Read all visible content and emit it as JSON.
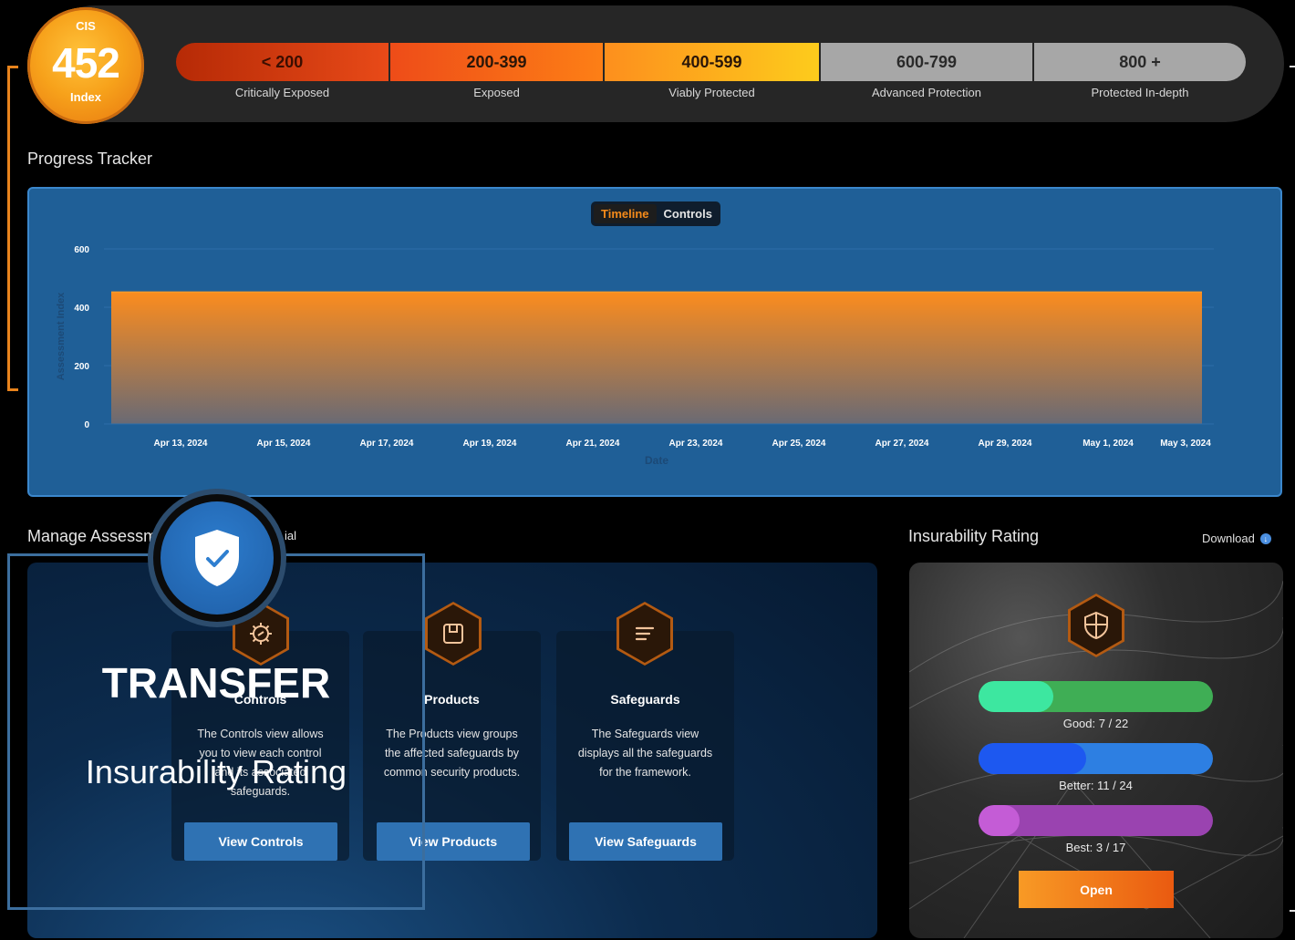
{
  "header": {
    "score": {
      "framework": "CIS",
      "value": "452",
      "label": "Index"
    },
    "bands": [
      {
        "range": "< 200",
        "label": "Critically Exposed"
      },
      {
        "range": "200-399",
        "label": "Exposed"
      },
      {
        "range": "400-599",
        "label": "Viably Protected"
      },
      {
        "range": "600-799",
        "label": "Advanced Protection"
      },
      {
        "range": "800 +",
        "label": "Protected In-depth"
      }
    ]
  },
  "progress": {
    "title": "Progress Tracker",
    "toggle": {
      "active": "Timeline",
      "inactive": "Controls"
    }
  },
  "chart_data": {
    "type": "area",
    "x": [
      "Apr 13, 2024",
      "Apr 15, 2024",
      "Apr 17, 2024",
      "Apr 19, 2024",
      "Apr 21, 2024",
      "Apr 23, 2024",
      "Apr 25, 2024",
      "Apr 27, 2024",
      "Apr 29, 2024",
      "May 1, 2024",
      "May 3, 2024"
    ],
    "series": [
      {
        "values": [
          452,
          452,
          452,
          452,
          452,
          452,
          452,
          452,
          452,
          452,
          452
        ]
      }
    ],
    "xlabel": "Date",
    "ylabel": "Assessment Index",
    "y_ticks": [
      "600",
      "400",
      "200",
      "0"
    ],
    "ylim": [
      0,
      600
    ],
    "grid": true,
    "fill_color_top": "#fb8c1e",
    "fill_color_bottom": "#6a6a74"
  },
  "manage": {
    "title_left": "Manage Assessm",
    "title_right": "ial",
    "cards": [
      {
        "title": "Controls",
        "desc": [
          "The Controls view allows",
          "you to view each control",
          "and its associated",
          "safeguards."
        ],
        "button": "View Controls",
        "icon": "gear-icon"
      },
      {
        "title": "Products",
        "desc": [
          "The Products view groups",
          "the affected safeguards by",
          "common security products."
        ],
        "button": "View Products",
        "icon": "box-icon"
      },
      {
        "title": "Safeguards",
        "desc": [
          "The Safeguards view",
          "displays all the safeguards",
          "for the framework."
        ],
        "button": "View Safeguards",
        "icon": "list-icon"
      }
    ]
  },
  "overlay": {
    "heading": "TRANSFER",
    "subheading": "Insurability Rating",
    "icon": "shield-check-icon"
  },
  "insurability": {
    "title": "Insurability Rating",
    "download": "Download",
    "bars": [
      {
        "label": "Good: 7 / 22",
        "fraction": 0.318,
        "track": "#3fae55",
        "fill": "#3de7a0"
      },
      {
        "label": "Better: 11 / 24",
        "fraction": 0.458,
        "track": "#2d7fe2",
        "fill": "#1d58f0"
      },
      {
        "label": "Best: 3 / 17",
        "fraction": 0.176,
        "track": "#9a43b0",
        "fill": "#c45cd6"
      }
    ],
    "open_button": "Open",
    "icon": "shield-icon"
  }
}
